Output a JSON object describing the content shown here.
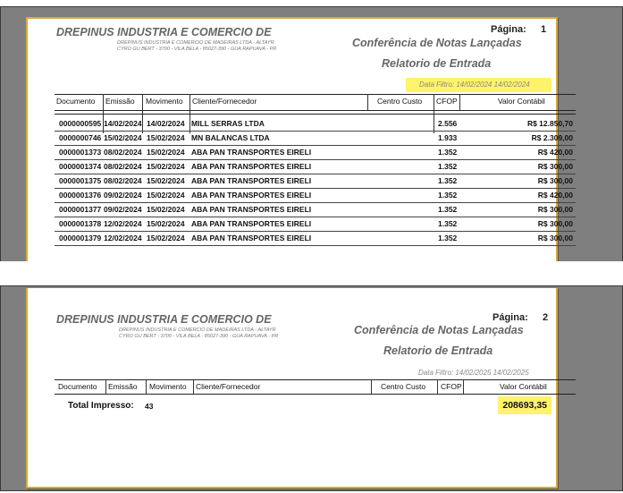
{
  "company": "DREPINUS INDUSTRIA E COMERCIO DE",
  "company_sub_line1": "DREPINUS INDUSTRIA E COMERCIO DE MADEIRAS LTDA - ALTAYR",
  "company_sub_line2": "CYRO GU BERT - 3700 - VILA BELA - 85027-390 - GUA RAPUAVA - PR",
  "report_title": "Conferência de Notas Lançadas",
  "report_subtitle": "Relatorio de Entrada",
  "page_label": "Página:",
  "columns": [
    "Documento",
    "Emissão",
    "Movimento",
    "Cliente/Fornecedor",
    "Centro Custo",
    "CFOP",
    "Valor Contábil"
  ],
  "page1": {
    "page_number": "1",
    "filter": "Data Filtro: 14/02/2024 14/02/2024",
    "rows": [
      {
        "doc": "0000000595",
        "emissao": "14/02/2024",
        "movimento": "14/02/2024",
        "cliente": "MILL SERRAS LTDA",
        "cfop": "2.556",
        "valor": "R$ 12.850,70"
      },
      {
        "doc": "0000000746",
        "emissao": "15/02/2024",
        "movimento": "15/02/2024",
        "cliente": "MN BALANCAS LTDA",
        "cfop": "1.933",
        "valor": "R$ 2.309,00"
      },
      {
        "doc": "0000001373",
        "emissao": "08/02/2024",
        "movimento": "15/02/2024",
        "cliente": "ABA PAN TRANSPORTES EIRELI",
        "cfop": "1.352",
        "valor": "R$ 420,00"
      },
      {
        "doc": "0000001374",
        "emissao": "08/02/2024",
        "movimento": "15/02/2024",
        "cliente": "ABA PAN TRANSPORTES EIRELI",
        "cfop": "1.352",
        "valor": "R$ 300,00"
      },
      {
        "doc": "0000001375",
        "emissao": "08/02/2024",
        "movimento": "15/02/2024",
        "cliente": "ABA PAN TRANSPORTES EIRELI",
        "cfop": "1.352",
        "valor": "R$ 300,00"
      },
      {
        "doc": "0000001376",
        "emissao": "09/02/2024",
        "movimento": "15/02/2024",
        "cliente": "ABA PAN TRANSPORTES EIRELI",
        "cfop": "1.352",
        "valor": "R$ 420,00"
      },
      {
        "doc": "0000001377",
        "emissao": "09/02/2024",
        "movimento": "15/02/2024",
        "cliente": "ABA PAN TRANSPORTES EIRELI",
        "cfop": "1.352",
        "valor": "R$ 300,00"
      },
      {
        "doc": "0000001378",
        "emissao": "12/02/2024",
        "movimento": "15/02/2024",
        "cliente": "ABA PAN TRANSPORTES EIRELI",
        "cfop": "1.352",
        "valor": "R$ 300,00"
      },
      {
        "doc": "0000001379",
        "emissao": "12/02/2024",
        "movimento": "15/02/2024",
        "cliente": "ABA PAN TRANSPORTES EIRELI",
        "cfop": "1.352",
        "valor": "R$ 300,00"
      }
    ]
  },
  "page2": {
    "page_number": "2",
    "filter": "Data Filtro: 14/02/2025 14/02/2025",
    "total_label": "Total Impresso:",
    "total_count": "43",
    "total_value": "208693,35"
  },
  "colors": {
    "highlight": "#fff36b",
    "page_border": "#d7a93a",
    "background": "#7f7f7f"
  }
}
